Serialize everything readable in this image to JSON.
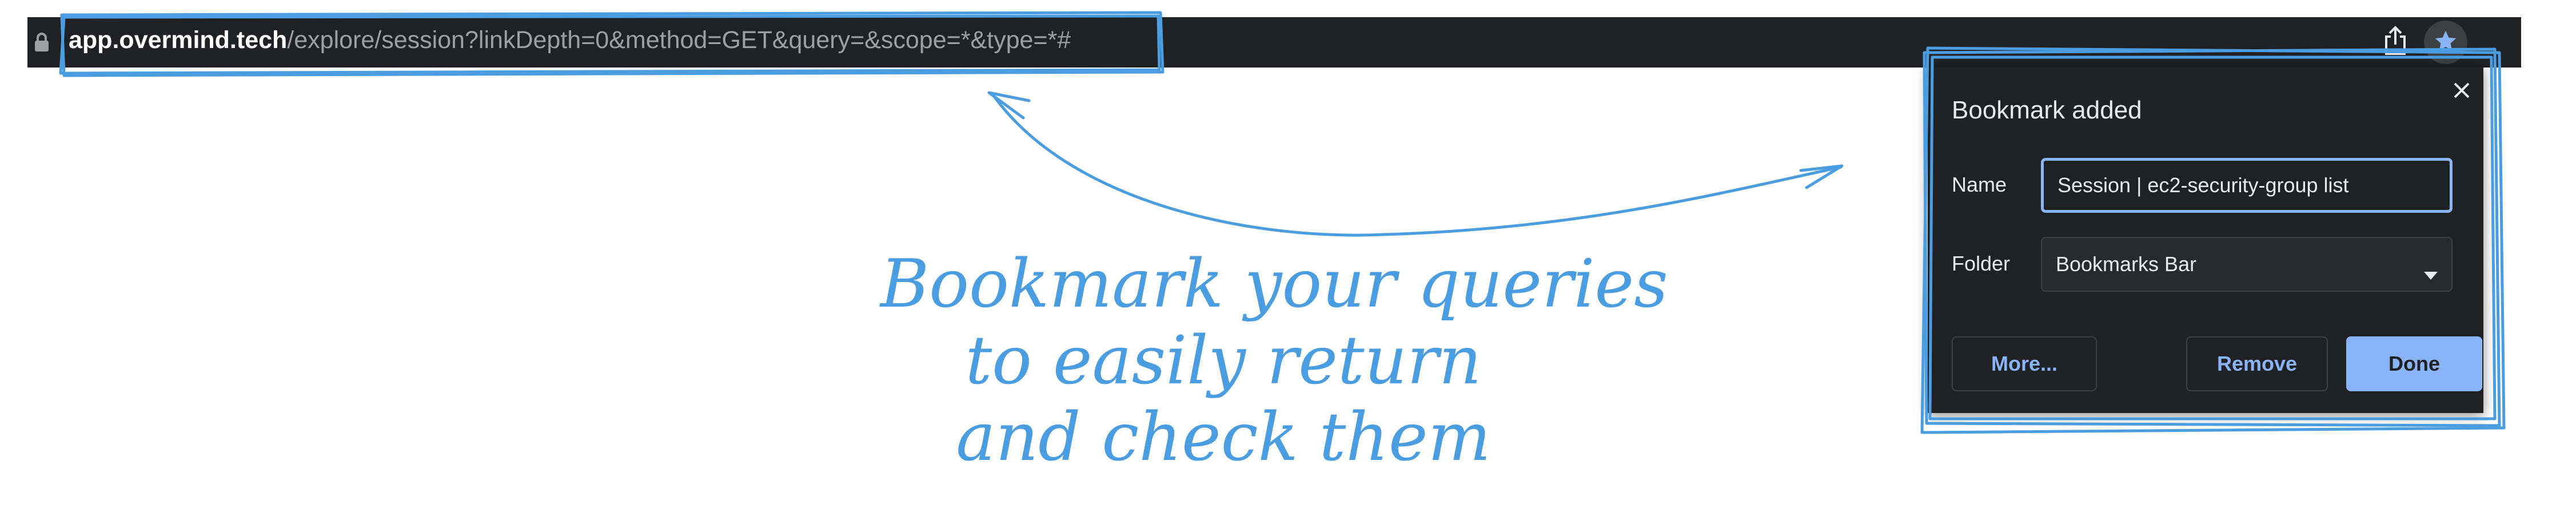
{
  "browser": {
    "url_host": "app.overmind.tech",
    "url_path": "/explore/session?linkDepth=0&method=GET&query=&scope=*&type=*#"
  },
  "bookmark_dialog": {
    "title": "Bookmark added",
    "name_label": "Name",
    "name_value": "Session | ec2-security-group list",
    "folder_label": "Folder",
    "folder_value": "Bookmarks Bar",
    "more_label": "More...",
    "remove_label": "Remove",
    "done_label": "Done"
  },
  "annotation": {
    "lines": [
      "Bookmark your queries",
      "to easily return",
      "and check them"
    ],
    "color": "#4a9de0"
  },
  "colors": {
    "accent": "#8ab4f8",
    "dialog_bg": "#202124"
  }
}
